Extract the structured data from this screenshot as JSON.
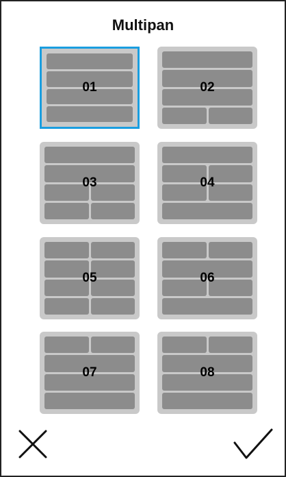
{
  "dialog": {
    "title": "Multipan",
    "selected_index": 0
  },
  "layouts": [
    {
      "label": "01",
      "rows": [
        1,
        1,
        1,
        1
      ]
    },
    {
      "label": "02",
      "rows": [
        1,
        1,
        1,
        2
      ]
    },
    {
      "label": "03",
      "rows": [
        1,
        1,
        2,
        2
      ]
    },
    {
      "label": "04",
      "rows": [
        1,
        2,
        2,
        1
      ]
    },
    {
      "label": "05",
      "rows": [
        2,
        2,
        2,
        2
      ]
    },
    {
      "label": "06",
      "rows": [
        2,
        1,
        2,
        1
      ]
    },
    {
      "label": "07",
      "rows": [
        2,
        1,
        1,
        1
      ]
    },
    {
      "label": "08",
      "rows": [
        2,
        1,
        1,
        1
      ]
    }
  ],
  "actions": {
    "cancel_icon": "close-icon",
    "confirm_icon": "checkmark-icon"
  },
  "colors": {
    "tile_background": "#c9c9c9",
    "panel": "#8c8c8c",
    "selected_border": "#1a9ee0"
  }
}
